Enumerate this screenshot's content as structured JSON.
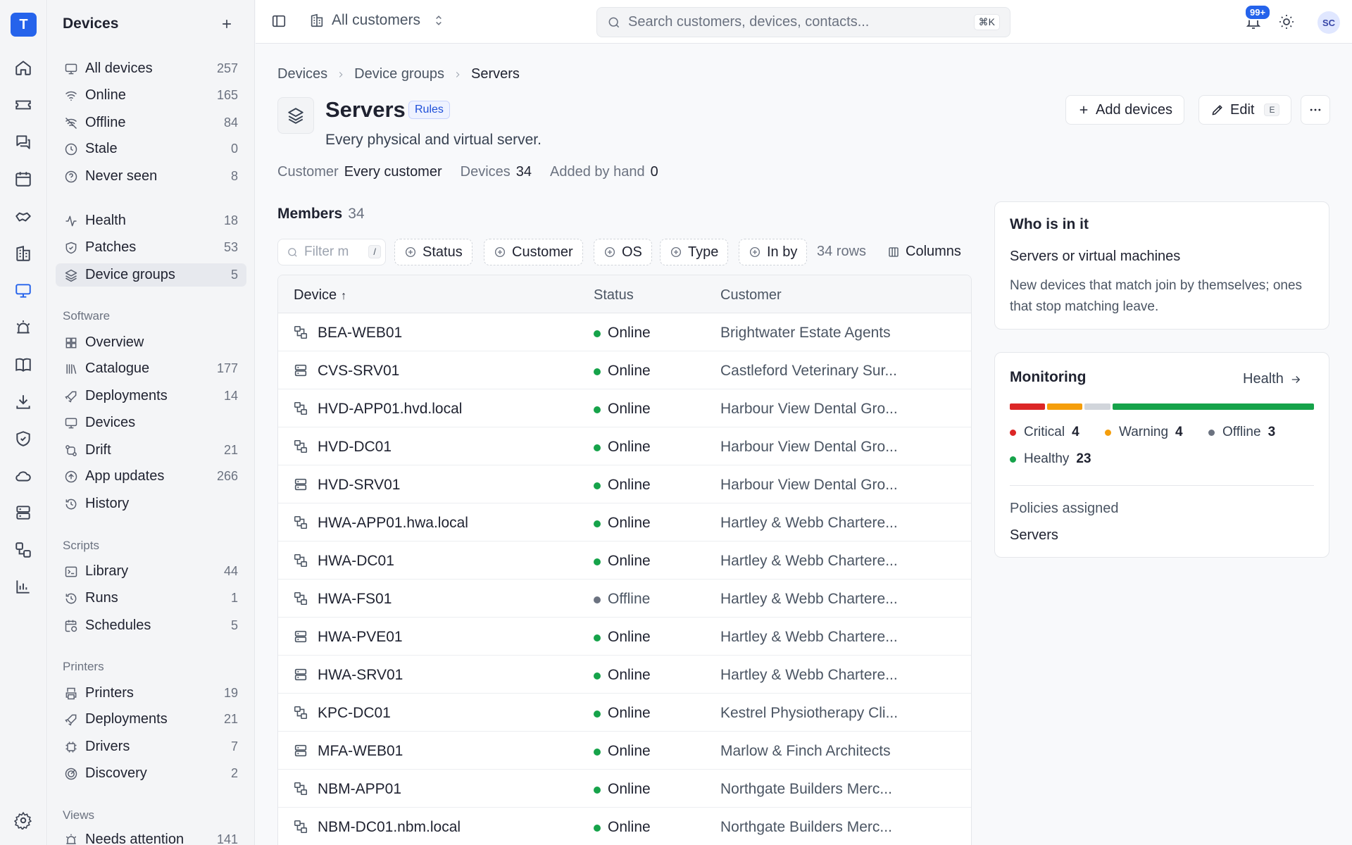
{
  "app": {
    "logo_letter": "T"
  },
  "rail": [
    "home-icon",
    "ticket-icon",
    "chat-icon",
    "calendar-icon",
    "handshake-icon",
    "building-icon",
    "monitor-icon",
    "alarm-icon",
    "book-icon",
    "download-icon",
    "shield-icon",
    "cloud-icon",
    "server-icon",
    "workflow-icon",
    "chart-icon",
    "settings-icon"
  ],
  "sidebar": {
    "title": "Devices",
    "devices": [
      {
        "label": "All devices",
        "count": "257",
        "icon": "monitor-icon"
      },
      {
        "label": "Online",
        "count": "165",
        "icon": "wifi-icon"
      },
      {
        "label": "Offline",
        "count": "84",
        "icon": "wifi-off-icon"
      },
      {
        "label": "Stale",
        "count": "0",
        "icon": "clock-icon"
      },
      {
        "label": "Never seen",
        "count": "8",
        "icon": "help-icon"
      }
    ],
    "groups": [
      {
        "label": "Health",
        "count": "18",
        "icon": "activity-icon"
      },
      {
        "label": "Patches",
        "count": "53",
        "icon": "shield-check-icon"
      },
      {
        "label": "Device groups",
        "count": "5",
        "icon": "layers-icon"
      }
    ],
    "software_title": "Software",
    "software": [
      {
        "label": "Overview",
        "count": "",
        "icon": "grid-icon"
      },
      {
        "label": "Catalogue",
        "count": "177",
        "icon": "library-icon"
      },
      {
        "label": "Deployments",
        "count": "14",
        "icon": "rocket-icon"
      },
      {
        "label": "Devices",
        "count": "",
        "icon": "monitor-down-icon"
      },
      {
        "label": "Drift",
        "count": "21",
        "icon": "git-compare-icon"
      },
      {
        "label": "App updates",
        "count": "266",
        "icon": "arrow-up-circle-icon"
      },
      {
        "label": "History",
        "count": "",
        "icon": "history-icon"
      }
    ],
    "scripts_title": "Scripts",
    "scripts": [
      {
        "label": "Library",
        "count": "44",
        "icon": "terminal-icon"
      },
      {
        "label": "Runs",
        "count": "1",
        "icon": "history-icon"
      },
      {
        "label": "Schedules",
        "count": "5",
        "icon": "calendar-clock-icon"
      }
    ],
    "printers_title": "Printers",
    "printers": [
      {
        "label": "Printers",
        "count": "19",
        "icon": "printer-icon"
      },
      {
        "label": "Deployments",
        "count": "21",
        "icon": "rocket-icon"
      },
      {
        "label": "Drivers",
        "count": "7",
        "icon": "chip-icon"
      },
      {
        "label": "Discovery",
        "count": "2",
        "icon": "radar-icon"
      }
    ],
    "views_title": "Views",
    "views": [
      {
        "label": "Needs attention",
        "count": "141",
        "icon": "alarm-icon"
      }
    ]
  },
  "topbar": {
    "customer_selector": "All customers",
    "search_placeholder": "Search customers, devices, contacts...",
    "search_shortcut": "⌘K",
    "notifications_badge": "99+",
    "avatar_initials": "SC"
  },
  "breadcrumb": [
    "Devices",
    "Device groups",
    "Servers"
  ],
  "page": {
    "title": "Servers",
    "badge": "Rules",
    "description": "Every physical and virtual server.",
    "meta": [
      {
        "key": "Customer",
        "value": "Every customer"
      },
      {
        "key": "Devices",
        "value": "34"
      },
      {
        "key": "Added by hand",
        "value": "0"
      }
    ],
    "actions": {
      "add": "Add devices",
      "edit": "Edit",
      "edit_shortcut": "E"
    }
  },
  "members": {
    "title": "Members",
    "count": "34",
    "filter_placeholder": "Filter m",
    "filter_shortcut": "/",
    "chips": [
      "Status",
      "Customer",
      "OS",
      "Type",
      "In by"
    ],
    "rows_label": "34 rows",
    "columns_label": "Columns"
  },
  "table": {
    "columns": [
      "Device",
      "Status",
      "Customer"
    ],
    "sort_indicator": "↑",
    "rows": [
      {
        "device": "BEA-WEB01",
        "type": "vm-icon",
        "status": "Online",
        "customer": "Brightwater Estate Agents"
      },
      {
        "device": "CVS-SRV01",
        "type": "server-icon",
        "status": "Online",
        "customer": "Castleford Veterinary Sur..."
      },
      {
        "device": "HVD-APP01.hvd.local",
        "type": "vm-icon",
        "status": "Online",
        "customer": "Harbour View Dental Gro..."
      },
      {
        "device": "HVD-DC01",
        "type": "vm-icon",
        "status": "Online",
        "customer": "Harbour View Dental Gro..."
      },
      {
        "device": "HVD-SRV01",
        "type": "server-icon",
        "status": "Online",
        "customer": "Harbour View Dental Gro..."
      },
      {
        "device": "HWA-APP01.hwa.local",
        "type": "vm-icon",
        "status": "Online",
        "customer": "Hartley & Webb Chartere..."
      },
      {
        "device": "HWA-DC01",
        "type": "vm-icon",
        "status": "Online",
        "customer": "Hartley & Webb Chartere..."
      },
      {
        "device": "HWA-FS01",
        "type": "vm-icon",
        "status": "Offline",
        "customer": "Hartley & Webb Chartere..."
      },
      {
        "device": "HWA-PVE01",
        "type": "server-icon",
        "status": "Online",
        "customer": "Hartley & Webb Chartere..."
      },
      {
        "device": "HWA-SRV01",
        "type": "server-icon",
        "status": "Online",
        "customer": "Hartley & Webb Chartere..."
      },
      {
        "device": "KPC-DC01",
        "type": "vm-icon",
        "status": "Online",
        "customer": "Kestrel Physiotherapy Cli..."
      },
      {
        "device": "MFA-WEB01",
        "type": "server-icon",
        "status": "Online",
        "customer": "Marlow & Finch Architects"
      },
      {
        "device": "NBM-APP01",
        "type": "vm-icon",
        "status": "Online",
        "customer": "Northgate Builders Merc..."
      },
      {
        "device": "NBM-DC01.nbm.local",
        "type": "vm-icon",
        "status": "Online",
        "customer": "Northgate Builders Merc..."
      }
    ]
  },
  "who_card": {
    "title": "Who is in it",
    "rule": "Servers or virtual machines",
    "note": "New devices that match join by themselves; ones that stop matching leave."
  },
  "monitoring": {
    "title": "Monitoring",
    "link": "Health",
    "legend": [
      {
        "label": "Critical",
        "value": "4",
        "color": "#dc2626"
      },
      {
        "label": "Warning",
        "value": "4",
        "color": "#f59e0b"
      },
      {
        "label": "Offline",
        "value": "3",
        "color": "#6b7280"
      },
      {
        "label": "Healthy",
        "value": "23",
        "color": "#16a34a"
      }
    ],
    "bar_colors": {
      "critical": "#dc2626",
      "warning": "#f59e0b",
      "offline": "#d1d5db",
      "healthy": "#16a34a"
    },
    "policies_label": "Policies assigned",
    "policies_value": "Servers"
  },
  "colors": {
    "accent": "#2563eb",
    "online": "#16a34a",
    "offline": "#6b7280"
  }
}
